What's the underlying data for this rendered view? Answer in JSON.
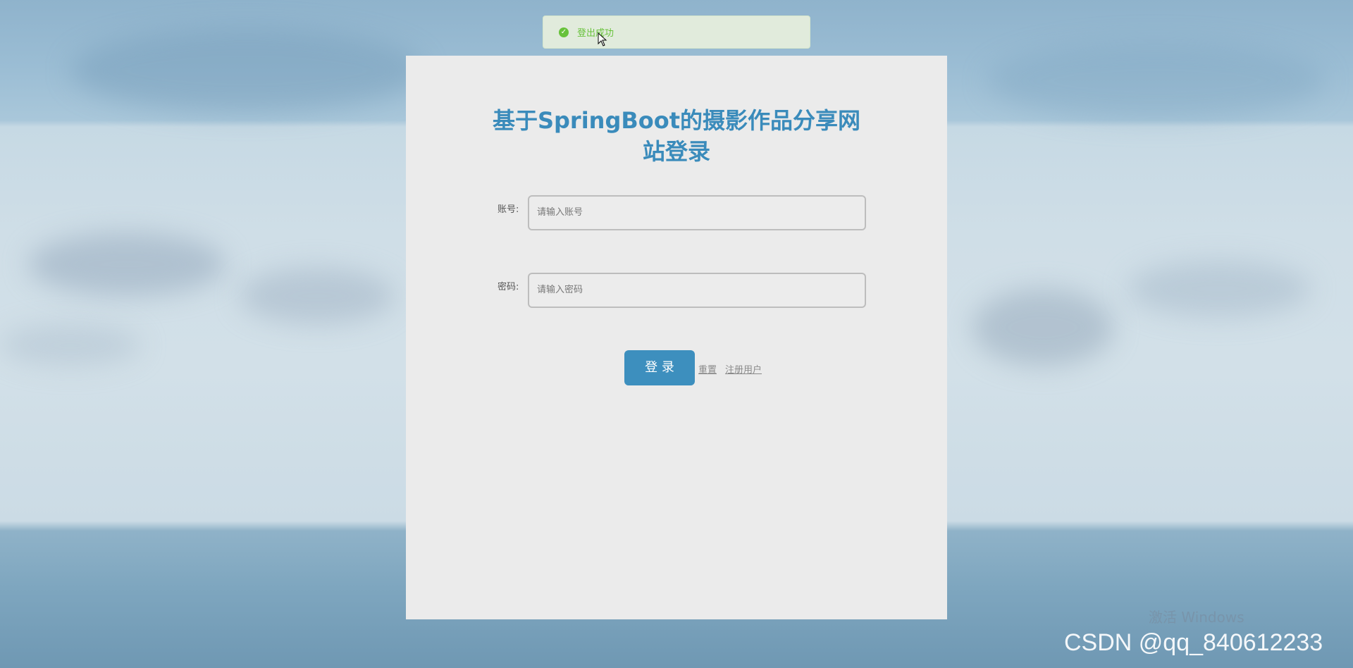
{
  "toast": {
    "message": "登出成功",
    "status_color": "#67c23a"
  },
  "login": {
    "title_line1": "基于SpringBoot的摄影作品分享网",
    "title_line2": "站登录",
    "account": {
      "label": "账号:",
      "placeholder": "请输入账号"
    },
    "password": {
      "label": "密码:",
      "placeholder": "请输入密码"
    },
    "login_button": "登 录",
    "reset_link": "重置",
    "register_link": "注册用户",
    "accent_color": "#3d8fbe"
  },
  "watermarks": {
    "windows": "激活 Windows",
    "csdn": "CSDN @qq_840612233"
  }
}
